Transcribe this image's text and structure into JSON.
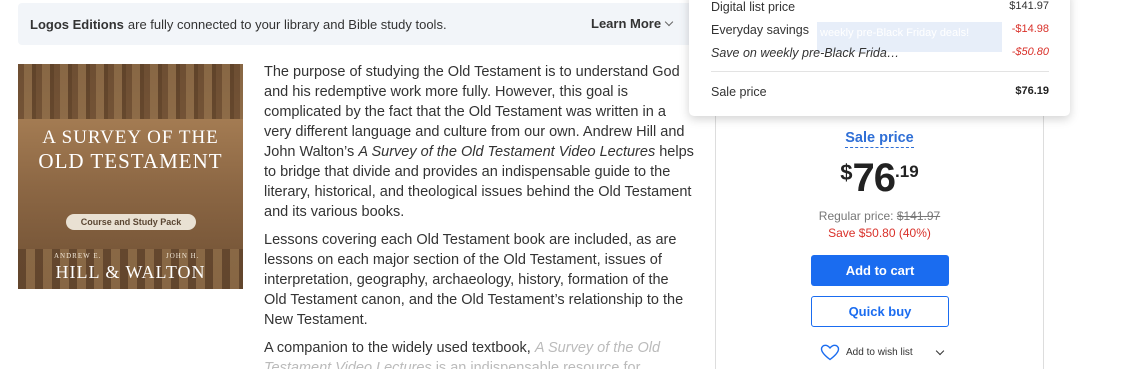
{
  "banner": {
    "strong": "Logos Editions",
    "text": "are fully connected to your library and Bible study tools.",
    "learn_more": "Learn More"
  },
  "cover": {
    "title_line1": "A SURVEY OF THE",
    "title_line2": "OLD TESTAMENT",
    "pill": "Course and Study Pack",
    "author_small_left": "ANDREW E.",
    "author_small_right": "JOHN H.",
    "authors": "HILL & WALTON"
  },
  "description": {
    "p1_a": "The purpose of studying the Old Testament is to understand God and his redemptive work more fully. However, this goal is complicated by the fact that the Old Testament was written in a very different language and culture from our own. Andrew Hill and John Walton’s ",
    "p1_title": "A Survey of the Old Testament Video Lectures",
    "p1_b": " helps to bridge that divide and provides an indispensable guide to the literary, historical, and theological issues behind the Old Testament and its various books.",
    "p2": "Lessons covering each Old Testament book are included, as are lessons on each major section of the Old Testament, issues of interpretation, geography, archaeology, history, formation of the Old Testament canon, and the Old Testament’s relationship to the New Testament.",
    "p3_a": "A companion to the widely used textbook, ",
    "p3_title": "A Survey of the Old Testament Video Lectures",
    "p3_b": " is an indispensable resource for"
  },
  "panel": {
    "sale_label": "Sale price",
    "currency": "$",
    "dollars": "76",
    "cents": ".19",
    "regular_label": "Regular price:",
    "regular_value": "$141.97",
    "save": "Save $50.80 (40%)",
    "add_to_cart": "Add to cart",
    "quick_buy": "Quick buy",
    "wish_list": "Add to wish list"
  },
  "popup": {
    "ghost_text": "weekly pre-Black Friday deals!",
    "rows": [
      {
        "label": "Digital list price",
        "value": "$141.97"
      },
      {
        "label": "Everyday savings",
        "value": "-$14.98"
      },
      {
        "label": "Save on weekly pre-Black Frida…",
        "value": "-$50.80"
      },
      {
        "label": "Sale price",
        "value": "$76.19"
      }
    ]
  },
  "colors": {
    "accent_blue": "#1a6cf0",
    "link_blue": "#2f6fd6",
    "savings_red": "#d9312a",
    "banner_bg": "#f2f5f9"
  },
  "icons": [
    "chevron-down-icon",
    "heart-outline-icon"
  ]
}
